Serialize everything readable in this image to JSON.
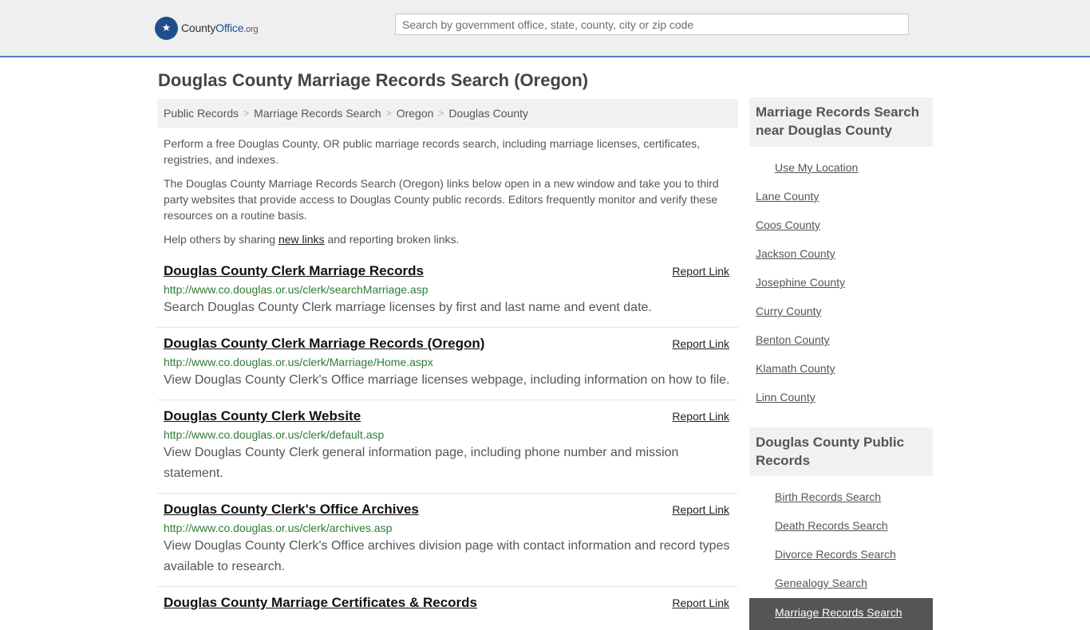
{
  "header": {
    "logo_brand": "County",
    "logo_office": "Office",
    "logo_tld": ".org",
    "search_placeholder": "Search by government office, state, county, city or zip code"
  },
  "page": {
    "title": "Douglas County Marriage Records Search (Oregon)"
  },
  "breadcrumb": [
    "Public Records",
    "Marriage Records Search",
    "Oregon",
    "Douglas County"
  ],
  "intro": {
    "p1": "Perform a free Douglas County, OR public marriage records search, including marriage licenses, certificates, registries, and indexes.",
    "p2": "The Douglas County Marriage Records Search (Oregon) links below open in a new window and take you to third party websites that provide access to Douglas County public records. Editors frequently monitor and verify these resources on a routine basis.",
    "p3_before": "Help others by sharing ",
    "p3_link": "new links",
    "p3_after": " and reporting broken links."
  },
  "report_label": "Report Link",
  "listings": [
    {
      "title": "Douglas County Clerk Marriage Records",
      "url": "http://www.co.douglas.or.us/clerk/searchMarriage.asp",
      "desc": "Search Douglas County Clerk marriage licenses by first and last name and event date."
    },
    {
      "title": "Douglas County Clerk Marriage Records (Oregon)",
      "url": "http://www.co.douglas.or.us/clerk/Marriage/Home.aspx",
      "desc": "View Douglas County Clerk's Office marriage licenses webpage, including information on how to file."
    },
    {
      "title": "Douglas County Clerk Website",
      "url": "http://www.co.douglas.or.us/clerk/default.asp",
      "desc": "View Douglas County Clerk general information page, including phone number and mission statement."
    },
    {
      "title": "Douglas County Clerk's Office Archives",
      "url": "http://www.co.douglas.or.us/clerk/archives.asp",
      "desc": "View Douglas County Clerk's Office archives division page with contact information and record types available to research."
    },
    {
      "title": "Douglas County Marriage Certificates & Records",
      "url": "",
      "desc": ""
    }
  ],
  "sidebar": {
    "nearby_title": "Marriage Records Search near Douglas County",
    "use_location": "Use My Location",
    "nearby": [
      "Lane County",
      "Coos County",
      "Jackson County",
      "Josephine County",
      "Curry County",
      "Benton County",
      "Klamath County",
      "Linn County"
    ],
    "public_title": "Douglas County Public Records",
    "public": [
      "Birth Records Search",
      "Death Records Search",
      "Divorce Records Search",
      "Genealogy Search"
    ],
    "active": "Marriage Records Search"
  },
  "colors": {
    "header_bg": "#efefef",
    "header_border": "#4b7fc1",
    "url_green": "#2e7d32",
    "side_active": "#555555"
  }
}
